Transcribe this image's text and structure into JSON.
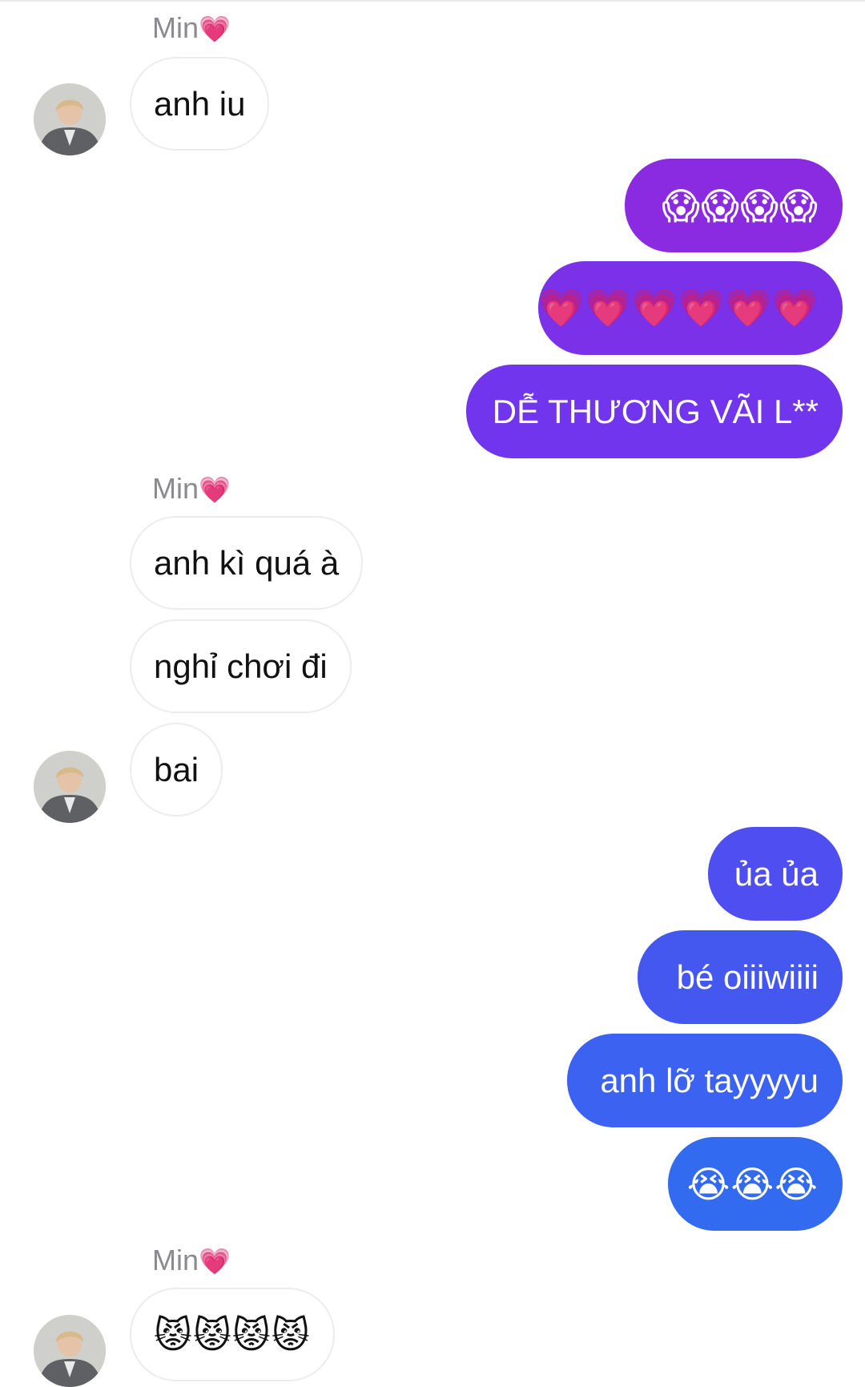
{
  "thread": {
    "incoming_sender": "Min",
    "incoming_sender_emoji": "💗",
    "messages": [
      {
        "id": 1,
        "direction": "in",
        "text": "anh iu"
      },
      {
        "id": 2,
        "direction": "out",
        "text": "😱😱😱😱"
      },
      {
        "id": 3,
        "direction": "out",
        "text": "💗💗💗💗💗💗"
      },
      {
        "id": 4,
        "direction": "out",
        "text": "DỄ THƯƠNG VÃI L**"
      },
      {
        "id": 5,
        "direction": "in",
        "text": "anh kì quá à"
      },
      {
        "id": 6,
        "direction": "in",
        "text": "nghỉ chơi đi"
      },
      {
        "id": 7,
        "direction": "in",
        "text": "bai"
      },
      {
        "id": 8,
        "direction": "out",
        "text": "ủa ủa"
      },
      {
        "id": 9,
        "direction": "out",
        "text": "bé oiiiwiiii"
      },
      {
        "id": 10,
        "direction": "out",
        "text": "anh lỡ tayyyyu"
      },
      {
        "id": 11,
        "direction": "out",
        "text": "😭😭😭"
      },
      {
        "id": 12,
        "direction": "in",
        "text": "😾😾😾😾"
      }
    ]
  },
  "colors": {
    "outgoing_gradient_top": "#8a2be2",
    "outgoing_gradient_mid": "#5b3df0",
    "outgoing_gradient_bottom": "#2f6bf0",
    "incoming_border": "#ececef",
    "sender_name": "#8a8a8f"
  }
}
